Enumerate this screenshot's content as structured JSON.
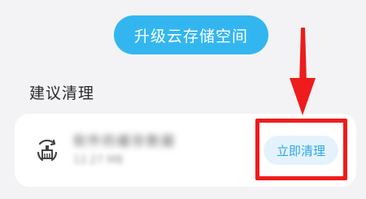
{
  "header": {
    "upgrade_label": "升级云存储空间"
  },
  "section": {
    "title": "建议清理"
  },
  "item": {
    "icon": "broom-cleanup-icon",
    "title": "软件的缓存数据",
    "subtitle": "12.27 MB",
    "action_label": "立即清理"
  },
  "colors": {
    "accent": "#33b6f0",
    "action_text": "#2ea6e4",
    "action_bg": "#e4f3fb",
    "highlight": "#ee1c1c"
  }
}
